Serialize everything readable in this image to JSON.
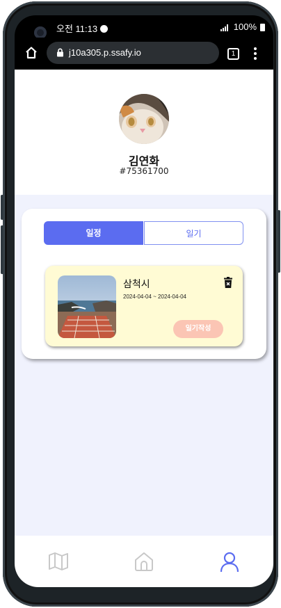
{
  "status_bar": {
    "time": "오전 11:13",
    "battery": "100%"
  },
  "browser": {
    "url": "j10a305.p.ssafy.io",
    "tab_count": "1"
  },
  "profile": {
    "name": "김연화",
    "id": "#75361700"
  },
  "tabs": [
    {
      "label": "일정",
      "active": true
    },
    {
      "label": "일기",
      "active": false
    }
  ],
  "schedule": {
    "title": "삼척시",
    "dates": "2024-04-04 ~ 2024-04-04",
    "write_label": "일기작성"
  },
  "bottom_nav": [
    "map-icon",
    "home-icon",
    "profile-icon"
  ],
  "colors": {
    "accent": "#5b6cf0",
    "card_bg": "#fffbd4",
    "write_btn": "#fbc5b4",
    "page_bg": "#f0f2fd"
  }
}
